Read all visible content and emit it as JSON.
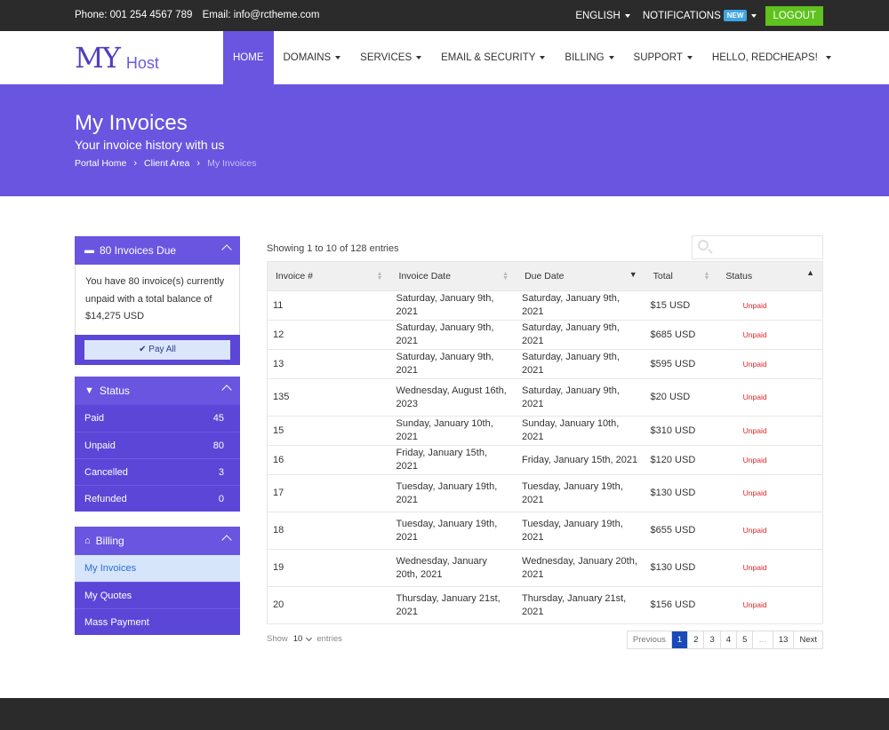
{
  "topbar": {
    "phone": "Phone: 001 254 4567 789",
    "email": "Email: info@rctheme.com",
    "language": "ENGLISH",
    "notifications": "NOTIFICATIONS",
    "new_badge": "NEW",
    "logout": "LOGOUT"
  },
  "logo": {
    "main": "MY",
    "sub": "Host"
  },
  "nav": {
    "home": "HOME",
    "domains": "DOMAINS",
    "services": "SERVICES",
    "email_security": "EMAIL & SECURITY",
    "billing": "BILLING",
    "support": "SUPPORT",
    "user": "HELLO, REDCHEAPS!"
  },
  "banner": {
    "title": "My Invoices",
    "subtitle": "Your invoice history with us",
    "breadcrumb": [
      "Portal Home",
      "Client Area",
      "My Invoices"
    ]
  },
  "sidebar": {
    "due": {
      "title": "80 Invoices Due",
      "text": "You have 80 invoice(s) currently unpaid with a total balance of $14,275 USD",
      "button": "Pay All"
    },
    "status": {
      "title": "Status",
      "items": [
        {
          "label": "Paid",
          "count": "45"
        },
        {
          "label": "Unpaid",
          "count": "80"
        },
        {
          "label": "Cancelled",
          "count": "3"
        },
        {
          "label": "Refunded",
          "count": "0"
        }
      ]
    },
    "billing": {
      "title": "Billing",
      "items": [
        "My Invoices",
        "My Quotes",
        "Mass Payment"
      ]
    }
  },
  "table": {
    "showing": "Showing 1 to 10 of 128 entries",
    "headers": [
      "Invoice #",
      "Invoice Date",
      "Due Date",
      "Total",
      "Status"
    ],
    "rows": [
      {
        "id": "11",
        "date": "Saturday, January 9th, 2021",
        "due": "Saturday, January 9th, 2021",
        "total": "$15 USD",
        "status": "Unpaid"
      },
      {
        "id": "12",
        "date": "Saturday, January 9th, 2021",
        "due": "Saturday, January 9th, 2021",
        "total": "$685 USD",
        "status": "Unpaid"
      },
      {
        "id": "13",
        "date": "Saturday, January 9th, 2021",
        "due": "Saturday, January 9th, 2021",
        "total": "$595 USD",
        "status": "Unpaid"
      },
      {
        "id": "135",
        "date": "Wednesday, August 16th, 2023",
        "due": "Saturday, January 9th, 2021",
        "total": "$20 USD",
        "status": "Unpaid"
      },
      {
        "id": "15",
        "date": "Sunday, January 10th, 2021",
        "due": "Sunday, January 10th, 2021",
        "total": "$310 USD",
        "status": "Unpaid"
      },
      {
        "id": "16",
        "date": "Friday, January 15th, 2021",
        "due": "Friday, January 15th, 2021",
        "total": "$120 USD",
        "status": "Unpaid"
      },
      {
        "id": "17",
        "date": "Tuesday, January 19th, 2021",
        "due": "Tuesday, January 19th, 2021",
        "total": "$130 USD",
        "status": "Unpaid"
      },
      {
        "id": "18",
        "date": "Tuesday, January 19th, 2021",
        "due": "Tuesday, January 19th, 2021",
        "total": "$655 USD",
        "status": "Unpaid"
      },
      {
        "id": "19",
        "date": "Wednesday, January 20th, 2021",
        "due": "Wednesday, January 20th, 2021",
        "total": "$130 USD",
        "status": "Unpaid"
      },
      {
        "id": "20",
        "date": "Thursday, January 21st, 2021",
        "due": "Thursday, January 21st, 2021",
        "total": "$156 USD",
        "status": "Unpaid"
      }
    ],
    "length": {
      "show": "Show",
      "value": "10",
      "entries": "entries"
    },
    "pager": [
      "Previous",
      "1",
      "2",
      "3",
      "4",
      "5",
      "…",
      "13",
      "Next"
    ],
    "current_page": "1"
  },
  "colors": {
    "accent": "#6a55e0",
    "accent_dark": "#5b46d8",
    "logout": "#5fc21e",
    "unpaid": "#e0252a",
    "page_active": "#1a49b8"
  }
}
